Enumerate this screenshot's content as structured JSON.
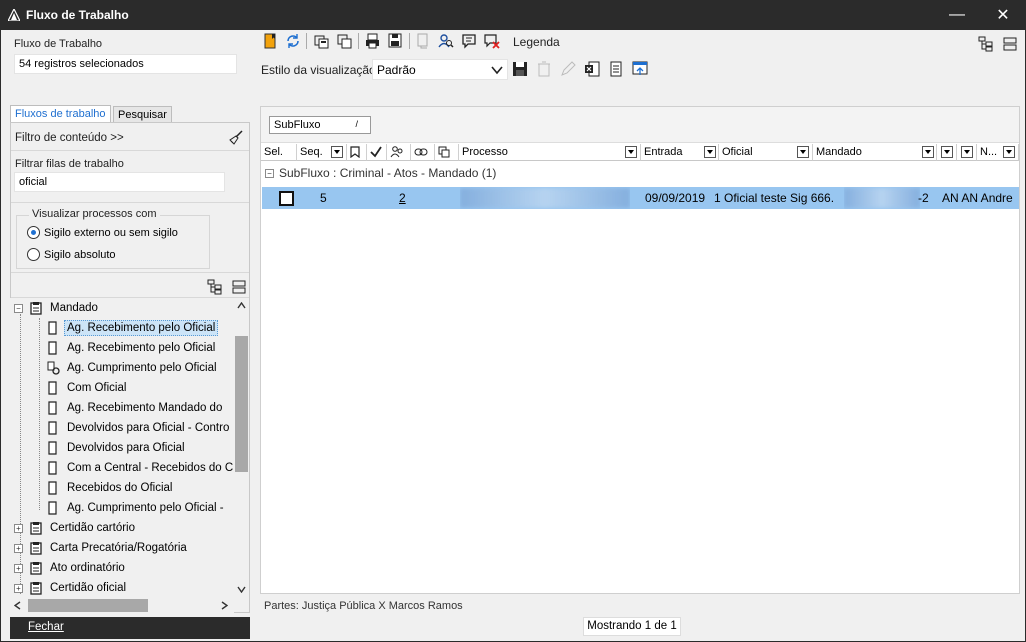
{
  "window": {
    "title": "Fluxo de Trabalho"
  },
  "form": {
    "workflow_label": "Fluxo de Trabalho",
    "workflow_value": "54 registros selecionados",
    "view_style_label": "Estilo da visualização",
    "view_style_value": "Padrão",
    "legend_label": "Legenda"
  },
  "left": {
    "tabs": [
      "Fluxos de trabalho",
      "Pesquisar"
    ],
    "content_filter": "Filtro de conteúdo >>",
    "queues_label": "Filtrar filas de trabalho",
    "queues_value": "oficial",
    "visibility_title": "Visualizar processos com",
    "visibility_options": [
      "Sigilo externo ou sem sigilo",
      "Sigilo absoluto"
    ],
    "tree": {
      "root": "Mandado",
      "children": [
        "Ag. Recebimento pelo Oficial",
        "Ag. Recebimento pelo Oficial",
        "Ag. Cumprimento pelo Oficial",
        "Com Oficial",
        "Ag. Recebimento Mandado do",
        "Devolvidos para Oficial - Contro",
        "Devolvidos para Oficial",
        "Com a Central - Recebidos do C",
        "Recebidos do Oficial",
        "Ag. Cumprimento pelo Oficial -"
      ],
      "siblings": [
        "Certidão cartório",
        "Carta Precatória/Rogatória",
        "Ato ordinatório",
        "Certidão oficial"
      ]
    },
    "close_label": "Fechar"
  },
  "grid": {
    "group_chip": "SubFluxo",
    "group_chip_sort": "/",
    "headers": {
      "sel": "Sel.",
      "seq": "Seq.",
      "processo": "Processo",
      "entrada": "Entrada",
      "oficial": "Oficial",
      "mandado": "Mandado",
      "n": "N..."
    },
    "group_row": "SubFluxo : Criminal - Atos - Mandado  (1)",
    "row": {
      "seq": "5",
      "link": "2",
      "entrada": "09/09/2019",
      "oficial": "1 Oficial teste Sig 666.",
      "mandado_suffix": "-2",
      "n": "AN AN Andre"
    }
  },
  "footer": {
    "partes": "Partes: Justiça Pública  X  Marcos Ramos",
    "status": "Mostrando 1 de 1"
  }
}
